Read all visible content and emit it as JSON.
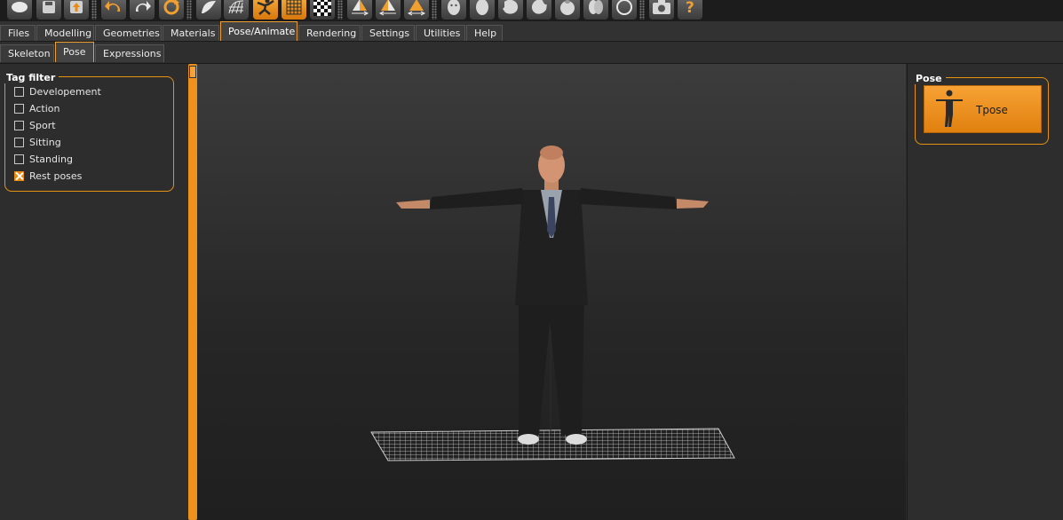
{
  "menu": {
    "tabs": [
      "Files",
      "Modelling",
      "Geometries",
      "Materials",
      "Pose/Animate",
      "Rendering",
      "Settings",
      "Utilities",
      "Help"
    ],
    "active": "Pose/Animate"
  },
  "submenu": {
    "tabs": [
      "Skeleton",
      "Pose",
      "Expressions"
    ],
    "active": "Pose"
  },
  "tag_filter": {
    "title": "Tag filter",
    "items": [
      {
        "label": "Developement",
        "checked": false
      },
      {
        "label": "Action",
        "checked": false
      },
      {
        "label": "Sport",
        "checked": false
      },
      {
        "label": "Sitting",
        "checked": false
      },
      {
        "label": "Standing",
        "checked": false
      },
      {
        "label": "Rest poses",
        "checked": true
      }
    ]
  },
  "pose_panel": {
    "title": "Pose",
    "items": [
      {
        "label": "Tpose",
        "selected": true
      }
    ]
  },
  "toolbar": {
    "icons": [
      "new-file-icon",
      "save-icon",
      "load-icon",
      "undo-icon",
      "redo-icon",
      "reset-icon",
      "smooth-icon",
      "wireframe-icon",
      "pose-icon",
      "grid-icon",
      "background-icon",
      "symmetry-right-icon",
      "symmetry-left-icon",
      "symmetry-icon",
      "front-view-icon",
      "back-view-icon",
      "left-view-icon",
      "right-view-icon",
      "top-view-icon",
      "bottom-view-icon",
      "reset-camera-icon",
      "screenshot-icon",
      "help-icon"
    ],
    "active": [
      "pose-icon",
      "grid-icon"
    ]
  },
  "colors": {
    "accent": "#f0a030",
    "background": "#2d2d2d"
  }
}
